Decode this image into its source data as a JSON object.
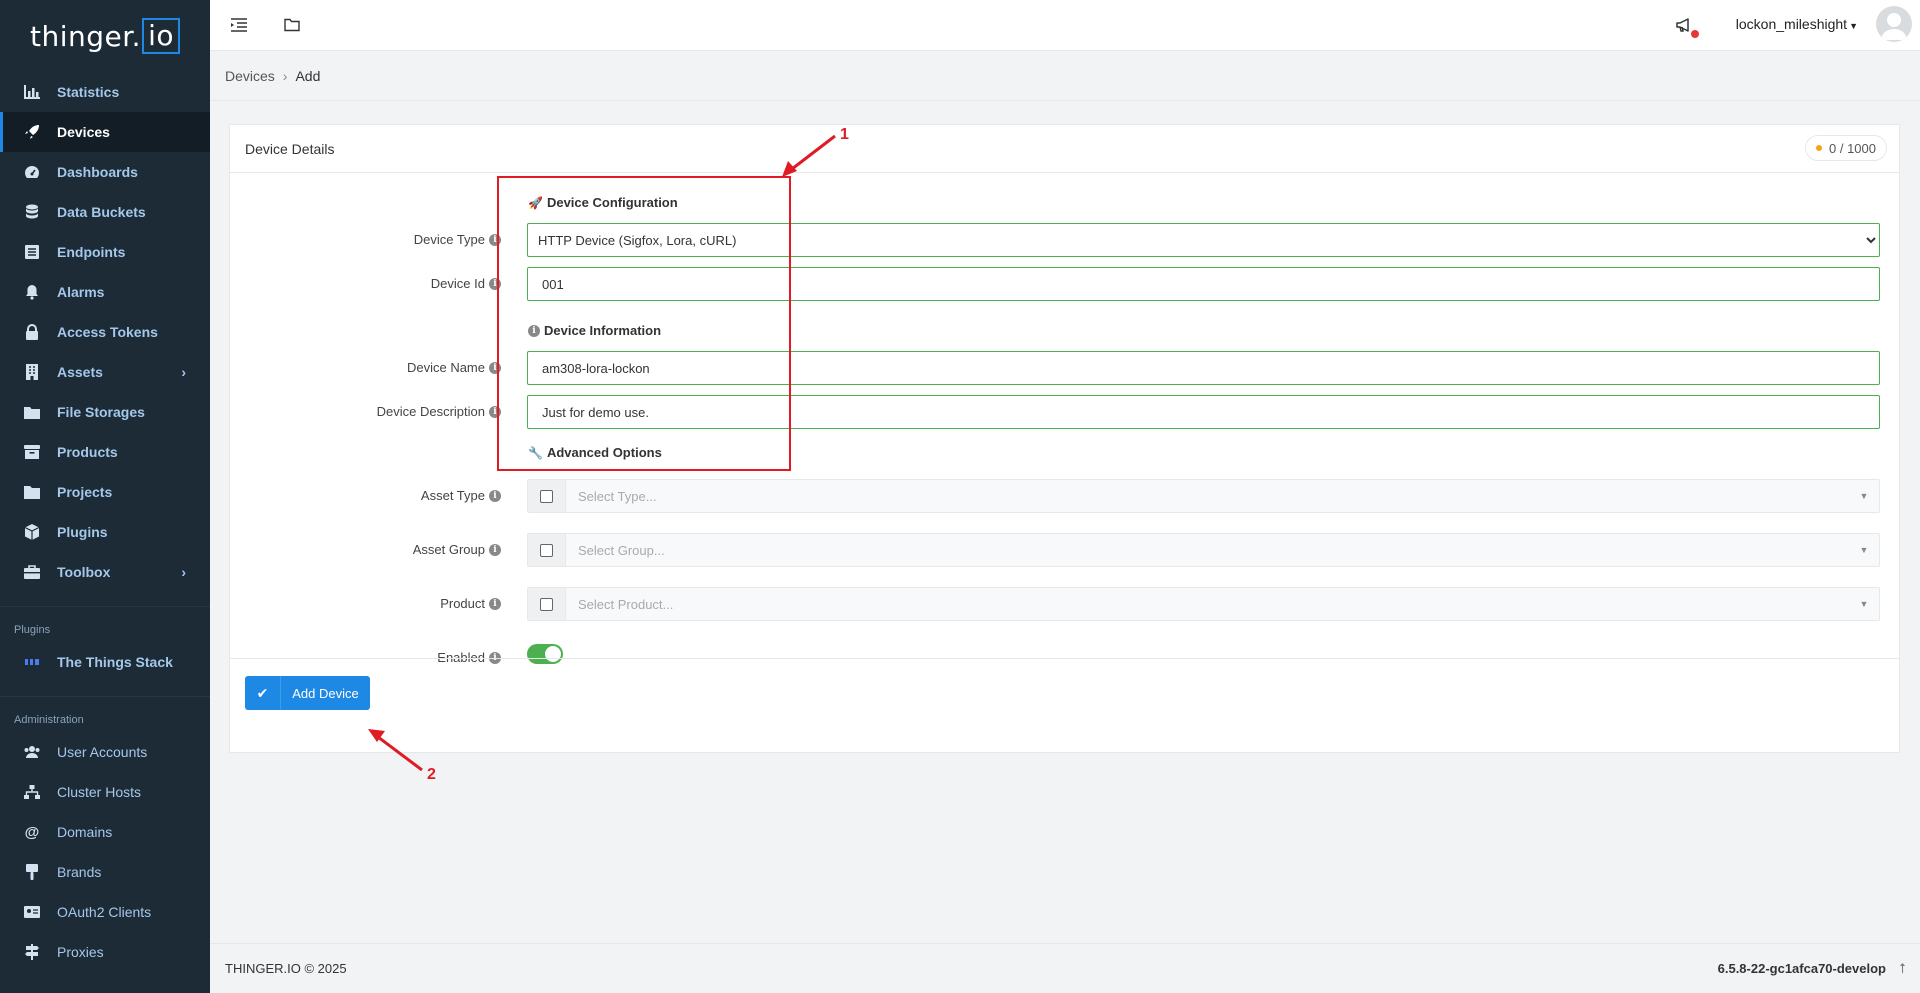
{
  "app": {
    "logo_main": "thinger.",
    "logo_box": "io"
  },
  "sidebar": {
    "items": [
      {
        "label": "Statistics",
        "icon": "bar-chart-icon"
      },
      {
        "label": "Devices",
        "icon": "rocket-icon",
        "active": true
      },
      {
        "label": "Dashboards",
        "icon": "gauge-icon"
      },
      {
        "label": "Data Buckets",
        "icon": "database-icon"
      },
      {
        "label": "Endpoints",
        "icon": "list-icon"
      },
      {
        "label": "Alarms",
        "icon": "bell-icon"
      },
      {
        "label": "Access Tokens",
        "icon": "lock-icon"
      },
      {
        "label": "Assets",
        "icon": "building-icon",
        "expandable": true
      },
      {
        "label": "File Storages",
        "icon": "files-icon"
      },
      {
        "label": "Products",
        "icon": "box-icon"
      },
      {
        "label": "Projects",
        "icon": "folder-icon"
      },
      {
        "label": "Plugins",
        "icon": "cube-icon"
      },
      {
        "label": "Toolbox",
        "icon": "toolbox-icon",
        "expandable": true
      }
    ],
    "plugins_section": "Plugins",
    "plugins": [
      {
        "label": "The Things Stack"
      }
    ],
    "admin_section": "Administration",
    "admin_items": [
      {
        "label": "User Accounts"
      },
      {
        "label": "Cluster Hosts"
      },
      {
        "label": "Domains"
      },
      {
        "label": "Brands"
      },
      {
        "label": "OAuth2 Clients"
      },
      {
        "label": "Proxies"
      }
    ]
  },
  "topbar": {
    "username": "lockon_mileshight"
  },
  "breadcrumb": {
    "parent": "Devices",
    "current": "Add"
  },
  "card": {
    "title": "Device Details",
    "counter": "0 / 1000",
    "section_config": "Device Configuration",
    "section_info": "Device Information",
    "section_advanced": "Advanced Options",
    "labels": {
      "device_type": "Device Type",
      "device_id": "Device Id",
      "device_name": "Device Name",
      "device_description": "Device Description",
      "asset_type": "Asset Type",
      "asset_group": "Asset Group",
      "product": "Product",
      "enabled": "Enabled"
    },
    "values": {
      "device_type": "HTTP Device (Sigfox, Lora, cURL)",
      "device_id": "001",
      "device_name": "am308-lora-lockon",
      "device_description": "Just for demo use."
    },
    "placeholders": {
      "asset_type": "Select Type...",
      "asset_group": "Select Group...",
      "product": "Select Product..."
    },
    "enabled": true,
    "add_button": "Add Device"
  },
  "annotations": {
    "num1": "1",
    "num2": "2"
  },
  "footer": {
    "copyright": "THINGER.IO © 2025",
    "version": "6.5.8-22-gc1afca70-develop"
  },
  "colors": {
    "sidebar_bg": "#1c2b36",
    "accent": "#1e88e5",
    "success": "#4caf50",
    "annotation": "#e01b24"
  }
}
